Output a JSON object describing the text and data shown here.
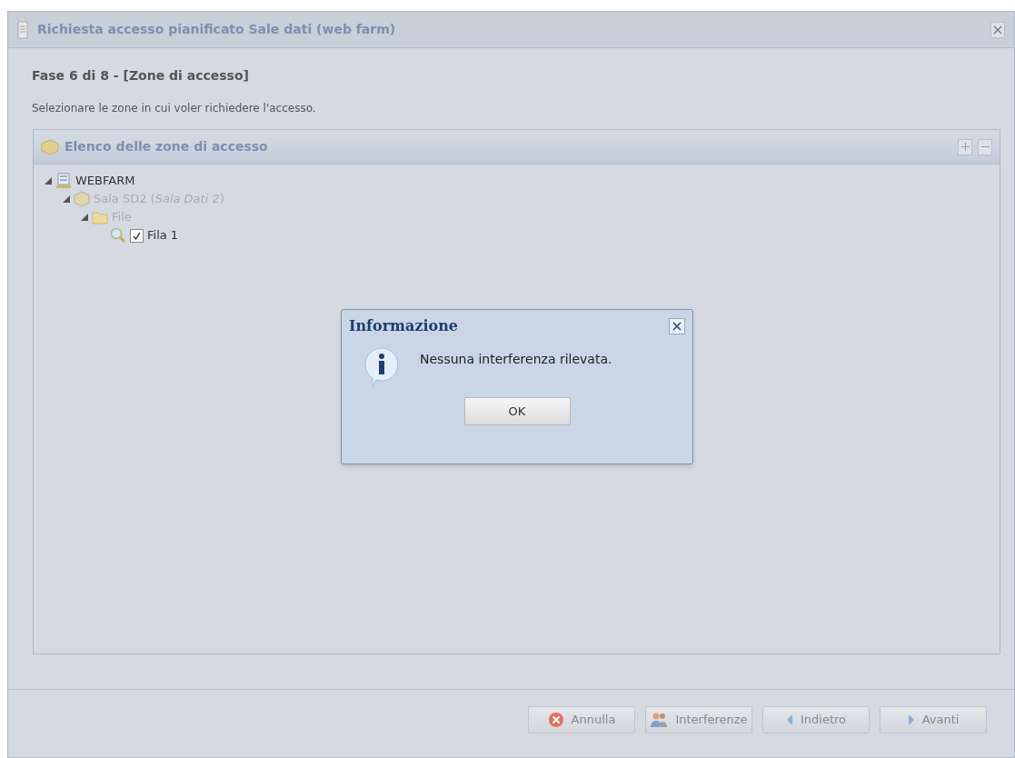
{
  "window": {
    "title": "Richiesta accesso pianificato Sale dati (web farm)"
  },
  "step": {
    "title": "Fase 6 di 8 - [Zone di accesso]",
    "instruction": "Selezionare le zone in cui voler richiedere l'accesso."
  },
  "panel": {
    "title": "Elenco delle zone di accesso"
  },
  "tree": [
    {
      "kind": "farm",
      "label": "WEBFARM",
      "disabled": false,
      "expanded": true,
      "children": [
        {
          "kind": "room",
          "label": "Sala SD2 (*Sala Dati 2*)",
          "disabled": true,
          "expanded": true,
          "children": [
            {
              "kind": "folder",
              "label": "File",
              "disabled": true,
              "expanded": true,
              "children": [
                {
                  "kind": "row",
                  "label": "Fila 1",
                  "disabled": false,
                  "checked": true
                }
              ]
            }
          ]
        }
      ]
    }
  ],
  "buttons": [
    {
      "kind": "cancel",
      "label": "Annulla"
    },
    {
      "kind": "people",
      "label": "Interferenze"
    },
    {
      "kind": "back",
      "label": "Indietro"
    },
    {
      "kind": "next",
      "label": "Avanti"
    }
  ],
  "dialog": {
    "title": "Informazione",
    "message": "Nessuna interferenza rilevata.",
    "button": "OK"
  }
}
